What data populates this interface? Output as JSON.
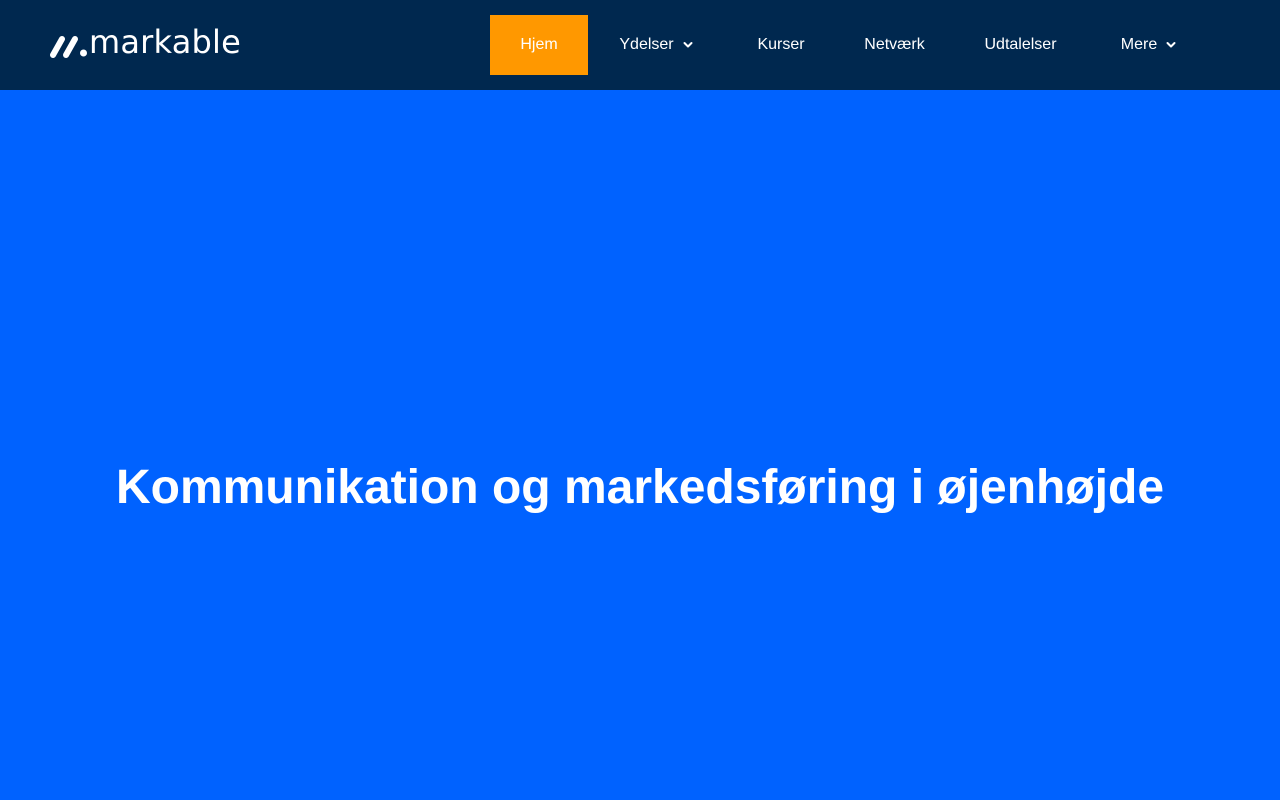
{
  "header": {
    "logo": {
      "text": "markable",
      "icon": "markable-logo-icon"
    },
    "nav": [
      {
        "label": "Hjem",
        "active": true,
        "has_dropdown": false
      },
      {
        "label": "Ydelser",
        "active": false,
        "has_dropdown": true,
        "icon": "chevron-down-icon"
      },
      {
        "label": "Kurser",
        "active": false,
        "has_dropdown": false
      },
      {
        "label": "Netværk",
        "active": false,
        "has_dropdown": false
      },
      {
        "label": "Udtalelser",
        "active": false,
        "has_dropdown": false
      },
      {
        "label": "Mere",
        "active": false,
        "has_dropdown": true,
        "icon": "chevron-down-icon"
      }
    ]
  },
  "hero": {
    "title": "Kommunikation og markedsføring i øjenhøjde"
  },
  "colors": {
    "header_bg": "#00284f",
    "hero_bg": "#0062ff",
    "active_nav_bg": "#ff9800",
    "text": "#ffffff"
  }
}
